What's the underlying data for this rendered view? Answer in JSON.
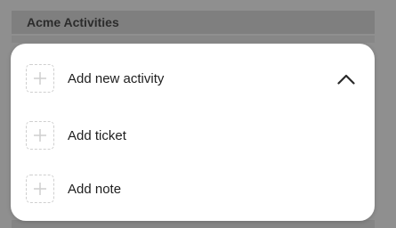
{
  "app": {
    "section_title": "Acme Activities"
  },
  "menu": {
    "items": [
      {
        "label": "Add new activity",
        "icon": "plus-icon"
      },
      {
        "label": "Add ticket",
        "icon": "plus-icon"
      },
      {
        "label": "Add note",
        "icon": "plus-icon"
      }
    ],
    "collapse_icon": "chevron-up-icon"
  },
  "colors": {
    "overlay": "#8f8f8f",
    "menu_background": "#ffffff",
    "text": "#1e1e1e",
    "icon_outline": "#cfcfcf"
  }
}
